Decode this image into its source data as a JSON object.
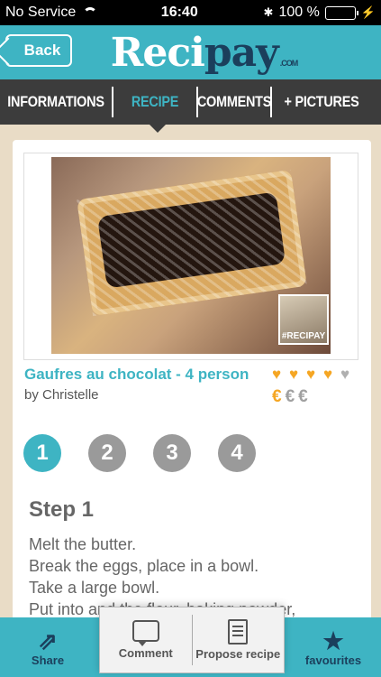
{
  "status_bar": {
    "carrier": "No Service",
    "time": "16:40",
    "battery": "100 %",
    "battery_color": "#4cd964"
  },
  "header": {
    "back_label": "Back",
    "logo_part1": "Reci",
    "logo_part2": "pay",
    "logo_suffix": ".COM",
    "accent_color": "#3eb4c3",
    "brand_color": "#1b3f5c"
  },
  "tabs": [
    {
      "label": "INFORMATIONS",
      "active": false
    },
    {
      "label": "RECIPE",
      "active": true
    },
    {
      "label": "COMMENTS",
      "active": false
    },
    {
      "label": "+ PICTURES",
      "active": false
    }
  ],
  "recipe": {
    "photo_tag": "#RECIPAY",
    "title": "Gaufres au chocolat - 4 person",
    "author": "by Christelle",
    "rating": 4,
    "rating_max": 5,
    "price_level": 1,
    "price_max": 3,
    "price_symbol": "€",
    "icon": "heart-icon"
  },
  "steps": {
    "numbers": [
      "1",
      "2",
      "3",
      "4"
    ],
    "active": 1,
    "heading": "Step 1",
    "lines": [
      "Melt the butter.",
      "Break the eggs, place in a bowl.",
      "Take a large bowl.",
      "Put into     and the flour, baking powder,"
    ]
  },
  "bottom_bar": {
    "share_label": "Share",
    "favourites_label": "favourites",
    "comment_label": "Comment",
    "propose_label": "Propose recipe",
    "icons": [
      "share-icon",
      "star-icon",
      "comment-icon",
      "document-icon"
    ]
  }
}
